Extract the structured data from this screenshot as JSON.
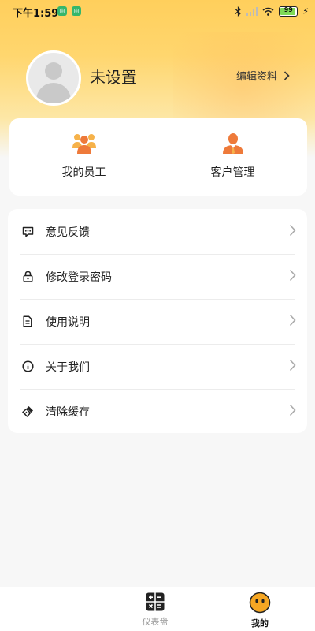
{
  "status_bar": {
    "time": "下午1:59",
    "battery": "99",
    "icons": [
      "bluetooth-icon",
      "signal-icon",
      "wifi-icon",
      "battery-icon",
      "charging-icon"
    ]
  },
  "profile": {
    "name": "未设置",
    "edit_label": "编辑资料"
  },
  "quick_actions": [
    {
      "label": "我的员工",
      "icon": "employees-icon"
    },
    {
      "label": "客户管理",
      "icon": "customer-icon"
    }
  ],
  "menu": [
    {
      "label": "意见反馈",
      "icon": "feedback-icon"
    },
    {
      "label": "修改登录密码",
      "icon": "lock-icon"
    },
    {
      "label": "使用说明",
      "icon": "document-icon"
    },
    {
      "label": "关于我们",
      "icon": "info-icon"
    },
    {
      "label": "清除缓存",
      "icon": "broom-icon"
    }
  ],
  "bottom_nav": [
    {
      "label": "仪表盘",
      "icon": "dashboard-icon",
      "active": false
    },
    {
      "label": "我的",
      "icon": "smiley-icon",
      "active": true
    }
  ],
  "colors": {
    "accent": "#f08a3c",
    "header": "#ffd264",
    "active_nav": "#f5a623"
  }
}
